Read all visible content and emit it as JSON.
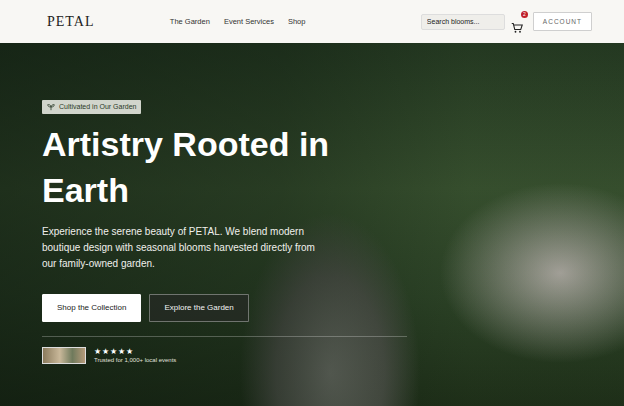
{
  "logo": "PETAL",
  "nav": [
    {
      "label": "The Garden"
    },
    {
      "label": "Event Services"
    },
    {
      "label": "Shop"
    }
  ],
  "search": {
    "placeholder": "Search blooms..."
  },
  "cart": {
    "count": "2"
  },
  "account": "ACCOUNT",
  "hero": {
    "badge": "Cultivated in Our Garden",
    "title": "Artistry Rooted in Earth",
    "text": "Experience the serene beauty of PETAL. We blend modern boutique design with seasonal blooms harvested directly from our family-owned garden.",
    "buttons": [
      "Shop the Collection",
      "Explore the Garden"
    ],
    "rating": {
      "stars": 5,
      "caption": "Trusted for 1,000+ local events"
    }
  }
}
